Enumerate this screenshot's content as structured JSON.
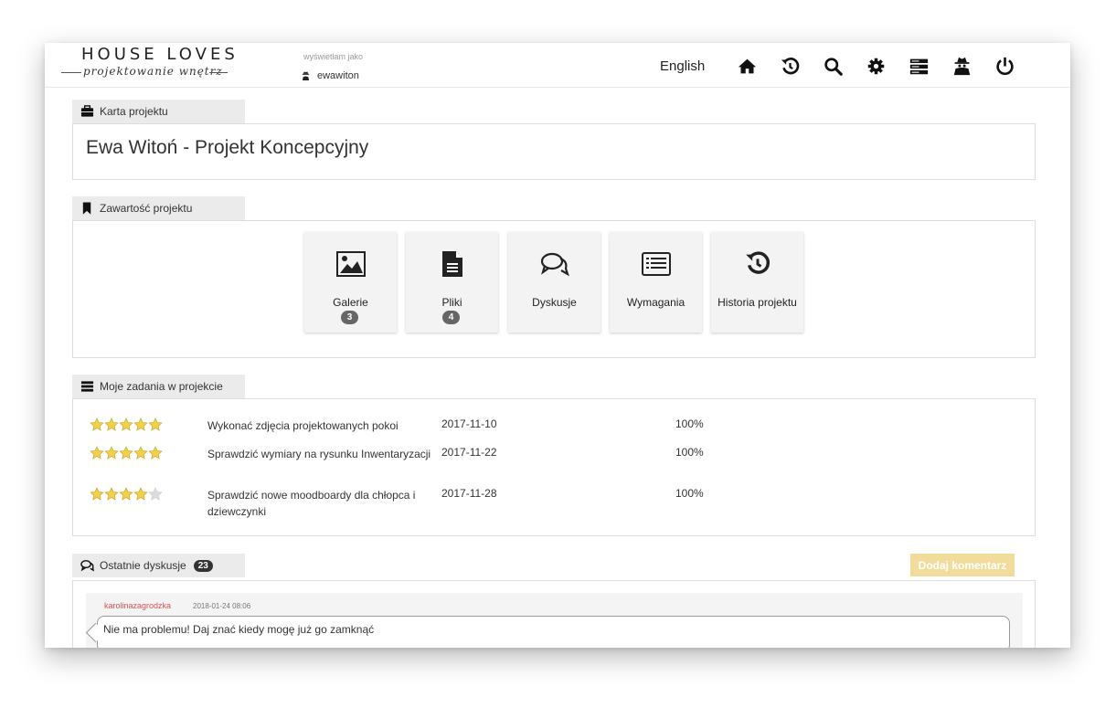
{
  "brand": {
    "name": "HOUSE LOVES",
    "tagline": "projektowanie wnętrz"
  },
  "header": {
    "viewing_as_label": "wyświetlam jako",
    "username": "ewawiton",
    "language": "English",
    "icons": [
      "home-icon",
      "history-icon",
      "search-icon",
      "gear-icon",
      "server-icon",
      "user-secret-icon",
      "power-icon"
    ]
  },
  "project_card": {
    "tab_label": "Karta projektu",
    "project_name": "Ewa Witoń - Projekt Koncepcyjny"
  },
  "content": {
    "tab_label": "Zawartość projektu",
    "tiles": [
      {
        "label": "Galerie",
        "badge": "3",
        "icon": "image-icon"
      },
      {
        "label": "Pliki",
        "badge": "4",
        "icon": "file-icon"
      },
      {
        "label": "Dyskusje",
        "badge": "",
        "icon": "comments-icon"
      },
      {
        "label": "Wymagania",
        "badge": "",
        "icon": "list-icon"
      },
      {
        "label": "Historia projektu",
        "badge": "",
        "icon": "history-icon"
      }
    ]
  },
  "tasks": {
    "tab_label": "Moje zadania w projekcie",
    "rows": [
      {
        "name": "Wykonać zdjęcia projektowanych pokoi",
        "date": "2017-11-10",
        "progress": "100%",
        "stars": 5
      },
      {
        "name": "Sprawdzić wymiary na rysunku Inwentaryzacji",
        "date": "2017-11-22",
        "progress": "100%",
        "stars": 5
      },
      {
        "name": "Sprawdzić nowe moodboardy dla chłopca i dziewczynki",
        "date": "2017-11-28",
        "progress": "100%",
        "stars": 4
      }
    ],
    "max_stars": 5
  },
  "discussions": {
    "tab_label": "Ostatnie dyskusje",
    "count": "23",
    "add_comment_label": "Dodaj komentarz",
    "latest": {
      "author": "karolinazagrodzka",
      "date": "2018-01-24 08:06",
      "text": "Nie ma problemu! Daj znać kiedy mogę już go zamknąć"
    }
  },
  "colors": {
    "star_filled": "#f2d04a",
    "star_empty": "#dddddd",
    "author": "#d9534f",
    "add_button": "#f1dc9b",
    "tab_bg": "#ebebeb"
  }
}
